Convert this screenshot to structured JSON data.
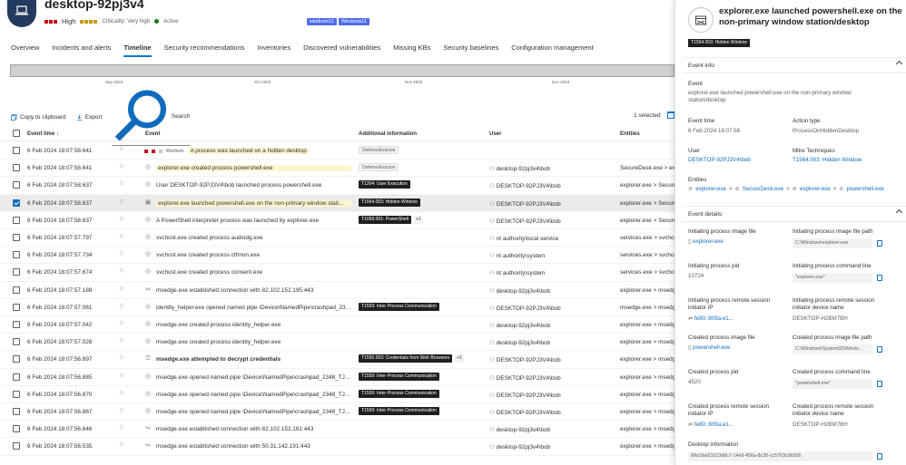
{
  "device": {
    "title": "desktop-92pj3v4",
    "risk": "High",
    "criticality": "Criticality: Very high",
    "status": "Active",
    "tags": [
      "windows11",
      "Windows11"
    ]
  },
  "tabs": [
    "Overview",
    "Incidents and alerts",
    "Timeline",
    "Security recommendations",
    "Inventories",
    "Discovered vulnerabilities",
    "Missing KBs",
    "Security baselines",
    "Configuration management"
  ],
  "active_tab": "Timeline",
  "timeline_months": [
    "Sep 2023",
    "Oct 2023",
    "Nov 2023",
    "Dec 2023"
  ],
  "toolbar": {
    "copy": "Copy to clipboard",
    "export": "Export",
    "search_placeholder": "Search",
    "selected": "1 selected"
  },
  "columns": {
    "time": "Event time ↓",
    "event": "Event",
    "additional": "Additional information",
    "user": "User",
    "entities": "Entities"
  },
  "rows": [
    {
      "time": "6 Feb 2024 18:07:58.641",
      "severity": "Medium",
      "event": "A process was launched on a hidden desktop",
      "style": "alert",
      "tags": [
        {
          "t": "DefenseEvasion",
          "k": "grey"
        }
      ],
      "user": "",
      "entities": ""
    },
    {
      "time": "6 Feb 2024 18:07:58.641",
      "event": "explorer.exe created process powershell.exe",
      "style": "hl",
      "tags": [
        {
          "t": "DefenseEvasion",
          "k": "grey"
        }
      ],
      "user": "desktop-92pj3v4\\bob",
      "entities": "SecureDesk.exe > expl"
    },
    {
      "time": "6 Feb 2024 18:07:58.637",
      "event": "User DESKTOP-92PJ3V4\\bob launched process powershell.exe",
      "style": "",
      "tags": [
        {
          "t": "T1204: User Execution",
          "k": "dark"
        }
      ],
      "user": "DESKTOP-92PJ3V4\\bob",
      "entities": "explorer.exe > Secure"
    },
    {
      "time": "6 Feb 2024 18:07:58.637",
      "event": "explorer.exe launched powershell.exe on the non-primary window stati...",
      "style": "hl",
      "tags": [
        {
          "t": "T1564.003: Hidden Window",
          "k": "dark"
        }
      ],
      "user": "DESKTOP-92PJ3V4\\bob",
      "entities": "explorer.exe > Secure",
      "selected": true
    },
    {
      "time": "6 Feb 2024 18:07:58.637",
      "event": "A PowerShell interpreter process was launched by explorer.exe",
      "style": "",
      "tags": [
        {
          "t": "T1059.001: PowerShell",
          "k": "dark"
        },
        {
          "t": "+1",
          "k": "plus"
        }
      ],
      "user": "DESKTOP-92PJ3V4\\bob",
      "entities": "explorer.exe > Secure"
    },
    {
      "time": "6 Feb 2024 18:07:57.797",
      "event": "svchost.exe created process audiodg.exe",
      "style": "",
      "tags": [],
      "user": "nt authority\\local service",
      "entities": "services.exe > svchost"
    },
    {
      "time": "6 Feb 2024 18:07:57.734",
      "event": "svchost.exe created process ctfmon.exe",
      "style": "",
      "tags": [],
      "user": "nt authority\\system",
      "entities": "services.exe > svchost"
    },
    {
      "time": "6 Feb 2024 18:07:57.674",
      "event": "svchost.exe created process consent.exe",
      "style": "",
      "tags": [],
      "user": "nt authority\\system",
      "entities": "services.exe > svchost"
    },
    {
      "time": "6 Feb 2024 18:07:57.188",
      "event": "msedge.exe established connection with 82.102.152.195:443",
      "style": "",
      "tags": [],
      "user": "desktop-92pj3v4\\bob",
      "entities": "explorer.exe > msedge"
    },
    {
      "time": "6 Feb 2024 18:07:57.061",
      "event": "identity_helper.exe opened named pipe \\Device\\NamedPipe\\crashpad_2348_...",
      "style": "",
      "tags": [
        {
          "t": "T1559: Inter-Process Communication",
          "k": "dark"
        }
      ],
      "user": "DESKTOP-92PJ3V4\\bob",
      "entities": "msedge.exe > msedge"
    },
    {
      "time": "6 Feb 2024 18:07:57.042",
      "event": "msedge.exe created process identity_helper.exe",
      "style": "",
      "tags": [],
      "user": "desktop-92pj3v4\\bob",
      "entities": "explorer.exe > msedge"
    },
    {
      "time": "6 Feb 2024 18:07:57.028",
      "event": "msedge.exe created process identity_helper.exe",
      "style": "",
      "tags": [],
      "user": "desktop-92pj3v4\\bob",
      "entities": "explorer.exe > msedge"
    },
    {
      "time": "6 Feb 2024 18:07:56.897",
      "event": "msedge.exe attempted to decrypt credentials",
      "style": "bold",
      "tags": [
        {
          "t": "T1555.003: Credentials from Web Browsers",
          "k": "dark"
        },
        {
          "t": "+1",
          "k": "plus"
        }
      ],
      "user": "DESKTOP-92PJ3V4\\bob",
      "entities": "explorer.exe > msedge"
    },
    {
      "time": "6 Feb 2024 18:07:56.885",
      "event": "msedge.exe opened named pipe \\Device\\NamedPipe\\crashpad_2348_TJMSD...",
      "style": "",
      "tags": [
        {
          "t": "T1559: Inter-Process Communication",
          "k": "dark"
        }
      ],
      "user": "DESKTOP-92PJ3V4\\bob",
      "entities": "explorer.exe > msedge"
    },
    {
      "time": "6 Feb 2024 18:07:56.870",
      "event": "msedge.exe opened named pipe \\Device\\NamedPipe\\crashpad_2348_TJMSD...",
      "style": "",
      "tags": [
        {
          "t": "T1559: Inter-Process Communication",
          "k": "dark"
        }
      ],
      "user": "DESKTOP-92PJ3V4\\bob",
      "entities": "explorer.exe > msedge"
    },
    {
      "time": "6 Feb 2024 18:07:56.867",
      "event": "msedge.exe opened named pipe \\Device\\NamedPipe\\crashpad_2348_TJMSD...",
      "style": "",
      "tags": [
        {
          "t": "T1559: Inter-Process Communication",
          "k": "dark"
        }
      ],
      "user": "DESKTOP-92PJ3V4\\bob",
      "entities": "explorer.exe > msedge"
    },
    {
      "time": "6 Feb 2024 18:07:56.646",
      "event": "msedge.exe established connection with 82.102.152.161:443",
      "style": "",
      "tags": [],
      "user": "desktop-92pj3v4\\bob",
      "entities": "explorer.exe > msedge"
    },
    {
      "time": "6 Feb 2024 18:07:56.535",
      "event": "msedge.exe established connection with 50.31.142.191:443",
      "style": "",
      "tags": [],
      "user": "desktop-92pj3v4\\bob",
      "entities": "explorer.exe > msedge"
    }
  ],
  "panel": {
    "title": "explorer.exe launched powershell.exe on the non-primary window station/desktop",
    "tag": "T1564.003: Hidden Window",
    "event_info": "Event info",
    "event_label": "Event",
    "event_value": "explorer.exe launched powershell.exe on the non-primary window station/desktop",
    "event_time_label": "Event time",
    "event_time_value": "6 Feb 2024 18:07:58",
    "action_type_label": "Action type",
    "action_type_value": "ProcessOnHiddenDesktop",
    "user_label": "User",
    "user_value": "DESKTOP-92PJ3V4\\bob",
    "mitre_label": "Mitre Techniques",
    "mitre_value": "T1564.003: Hidden Window",
    "entities_label": "Entities",
    "entities": [
      "explorer.exe",
      "SecureDesk.exe",
      "explorer.exe",
      "powershell.exe"
    ],
    "event_details": "Event details",
    "d_init_img_label": "Initiating process image file",
    "d_init_img_value": "explorer.exe",
    "d_init_path_label": "Initiating process image file path",
    "d_init_path_value": "C:\\Windows\\explorer.exe",
    "d_init_pid_label": "Initiating process pid",
    "d_init_pid_value": "10724",
    "d_init_cmd_label": "Initiating process command line",
    "d_init_cmd_value": "\"explorer.exe\"",
    "d_init_rip_label": "Initiating process remote session initiator IP",
    "d_init_rip_value": "fe80::809a:e1...",
    "d_init_rdev_label": "Initiating process remote session initiator device name",
    "d_init_rdev_value": "DESKTOP-H2BM7BH",
    "d_cr_img_label": "Created process image file",
    "d_cr_img_value": "powershell.exe",
    "d_cr_path_label": "Created process image file path",
    "d_cr_path_value": "C:\\Windows\\System32\\Windo...",
    "d_cr_pid_label": "Created process pid",
    "d_cr_pid_value": "4520",
    "d_cr_cmd_label": "Created process command line",
    "d_cr_cmd_value": "\"powershell.exe\"",
    "d_cr_rip_label": "Created process remote session initiator IP",
    "d_cr_rip_value": "fe80::809a:e1...",
    "d_cr_rdev_label": "Created process remote session initiator device name",
    "d_cr_rdev_value": "DESKTOP-H2BM7BH",
    "d_desk_label": "Desktop information",
    "d_desk_value": "WinSta0\\1013d8c7-14e9-456a-8c30-cc5763c0b926"
  }
}
